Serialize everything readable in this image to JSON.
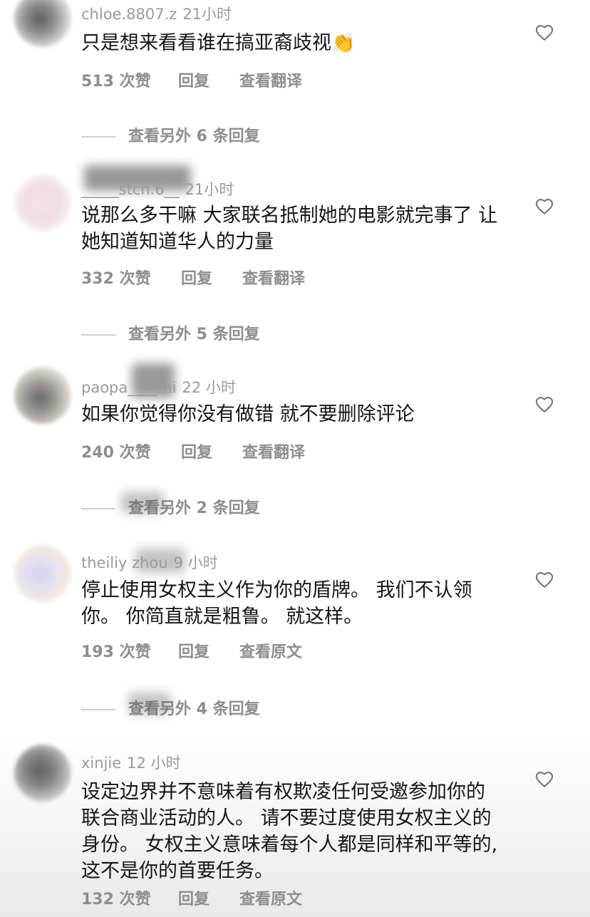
{
  "comments": [
    {
      "username": "chloe.8807.z",
      "time": "21小时",
      "text": "只是想来看看谁在搞亚裔歧视👏",
      "likes": "513 次赞",
      "reply": "回复",
      "translate": "查看翻译",
      "more_replies": "查看另外 6 条回复"
    },
    {
      "username": "_____stcn.6__",
      "time": "21小时",
      "text": "说那么多干嘛 大家联名抵制她的电影就完事了 让她知道知道华人的力量",
      "likes": "332 次赞",
      "reply": "回复",
      "translate": "查看翻译",
      "more_replies": "查看另外 5 条回复"
    },
    {
      "username": "paopa____mi",
      "time": "22 小时",
      "text": "如果你觉得你没有做错 就不要删除评论",
      "likes": "240 次赞",
      "reply": "回复",
      "translate": "查看翻译",
      "more_replies": "查看另外 2 条回复"
    },
    {
      "username": "theiliy zhou",
      "time": "9 小时",
      "text": "停止使用女权主义作为你的盾牌。 我们不认领你。 你简直就是粗鲁。 就这样。",
      "likes": "193 次赞",
      "reply": "回复",
      "translate": "查看原文",
      "more_replies": "查看另外 4 条回复"
    },
    {
      "username": "xinjie",
      "time": "12 小时",
      "text": "设定边界并不意味着有权欺凌任何受邀参加你的联合商业活动的人。 请不要过度使用女权主义的身份。 女权主义意味着每个人都是同样和平等的,这不是你的首要任务。",
      "likes": "132 次赞",
      "reply": "回复",
      "translate": "查看原文"
    }
  ],
  "icons": {
    "like": "heart-outline-icon"
  },
  "colors": {
    "text": "#151515",
    "muted": "#8e8e8e",
    "meta": "#9a9a9a"
  }
}
